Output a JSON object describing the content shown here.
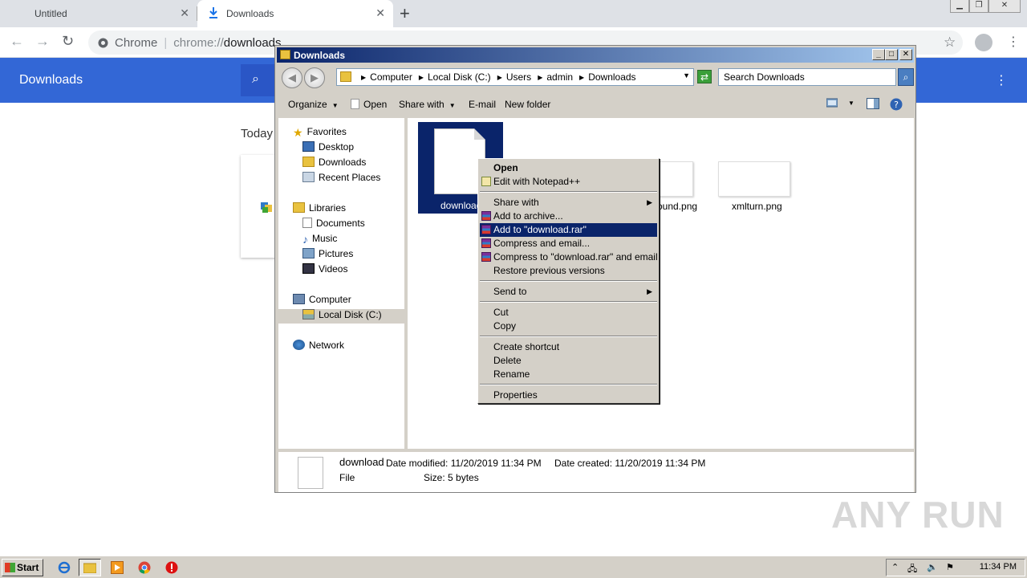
{
  "browser": {
    "tabs": [
      {
        "label": "Untitled"
      },
      {
        "label": "Downloads"
      }
    ],
    "omnibox": {
      "site_label": "Chrome",
      "url_scheme": "chrome://",
      "url_host": "downloads"
    },
    "page": {
      "title": "Downloads",
      "section": "Today"
    }
  },
  "explorer": {
    "title": "Downloads",
    "breadcrumb": [
      "Computer",
      "Local Disk (C:)",
      "Users",
      "admin",
      "Downloads"
    ],
    "search_placeholder": "Search Downloads",
    "commands": {
      "organize": "Organize",
      "open": "Open",
      "share_with": "Share with",
      "email": "E-mail",
      "new_folder": "New folder"
    },
    "nav": {
      "favorites": "Favorites",
      "desktop": "Desktop",
      "downloads": "Downloads",
      "recent_places": "Recent Places",
      "libraries": "Libraries",
      "documents": "Documents",
      "music": "Music",
      "pictures": "Pictures",
      "videos": "Videos",
      "computer": "Computer",
      "local_disk": "Local Disk (C:)",
      "network": "Network"
    },
    "files": [
      {
        "name": "download",
        "selected": true
      },
      {
        "name": "ound.png"
      },
      {
        "name": "xmlturn.png"
      }
    ],
    "details": {
      "name": "download",
      "type": "File",
      "date_modified": "Date modified: 11/20/2019 11:34 PM",
      "date_created": "Date created: 11/20/2019 11:34 PM",
      "size": "Size: 5 bytes"
    }
  },
  "context_menu": {
    "open": "Open",
    "edit_notepad": "Edit with Notepad++",
    "share_with": "Share with",
    "add_archive": "Add to archive...",
    "add_rar": "Add to \"download.rar\"",
    "compress_email": "Compress and email...",
    "compress_rar_email": "Compress to \"download.rar\" and email",
    "restore": "Restore previous versions",
    "send_to": "Send to",
    "cut": "Cut",
    "copy": "Copy",
    "create_shortcut": "Create shortcut",
    "delete": "Delete",
    "rename": "Rename",
    "properties": "Properties"
  },
  "watermark": "ANY RUN",
  "taskbar": {
    "start": "Start",
    "clock": "11:34 PM"
  },
  "colors": {
    "chrome_blue": "#3367d6",
    "selection": "#0a246a",
    "classic_gray": "#d4d0c8"
  }
}
